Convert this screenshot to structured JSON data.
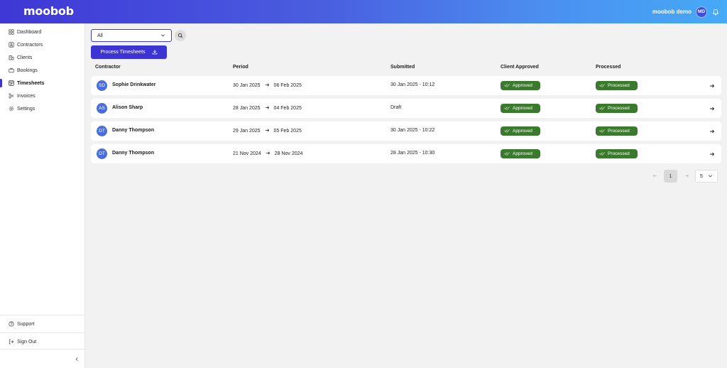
{
  "header": {
    "logo": "moobob",
    "user_name": "moobob demo",
    "user_initials": "MD"
  },
  "sidebar": {
    "items": [
      {
        "label": "Dashboard",
        "icon": "grid-icon"
      },
      {
        "label": "Contractors",
        "icon": "user-square-icon"
      },
      {
        "label": "Clients",
        "icon": "building-icon"
      },
      {
        "label": "Bookings",
        "icon": "briefcase-icon"
      },
      {
        "label": "Timesheets",
        "icon": "timesheet-icon",
        "active": true
      },
      {
        "label": "Invoices",
        "icon": "invoice-icon"
      },
      {
        "label": "Settings",
        "icon": "gear-icon"
      }
    ],
    "support_label": "Support",
    "signout_label": "Sign Out"
  },
  "filter": {
    "selected": "All"
  },
  "actions": {
    "process_label": "Process Timesheets"
  },
  "table": {
    "columns": [
      "Contractor",
      "Period",
      "Submitted",
      "Client Approved",
      "Processed"
    ],
    "rows": [
      {
        "initials": "SD",
        "name": "Sophie Drinkwater",
        "start": "30 Jan 2025",
        "end": "06 Feb 2025",
        "submitted": "30 Jan 2025 - 10:12",
        "approved": "Approved",
        "processed": "Processed"
      },
      {
        "initials": "AS",
        "name": "Alison Sharp",
        "start": "28 Jan 2025",
        "end": "04 Feb 2025",
        "submitted": "Draft",
        "approved": "Approved",
        "processed": "Processed"
      },
      {
        "initials": "DT",
        "name": "Danny Thompson",
        "start": "29 Jan 2025",
        "end": "05 Feb 2025",
        "submitted": "30 Jan 2025 - 10:22",
        "approved": "Approved",
        "processed": "Processed"
      },
      {
        "initials": "DT",
        "name": "Danny Thompson",
        "start": "21 Nov 2024",
        "end": "28 Nov 2024",
        "submitted": "28 Jan 2025 - 10:30",
        "approved": "Approved",
        "processed": "Processed"
      }
    ]
  },
  "pagination": {
    "current_page": "1",
    "page_size": "5"
  },
  "colors": {
    "primary": "#3c35d3",
    "success": "#3b7a2e",
    "gradient_start": "#3f37d6",
    "gradient_end": "#46aaf6"
  }
}
